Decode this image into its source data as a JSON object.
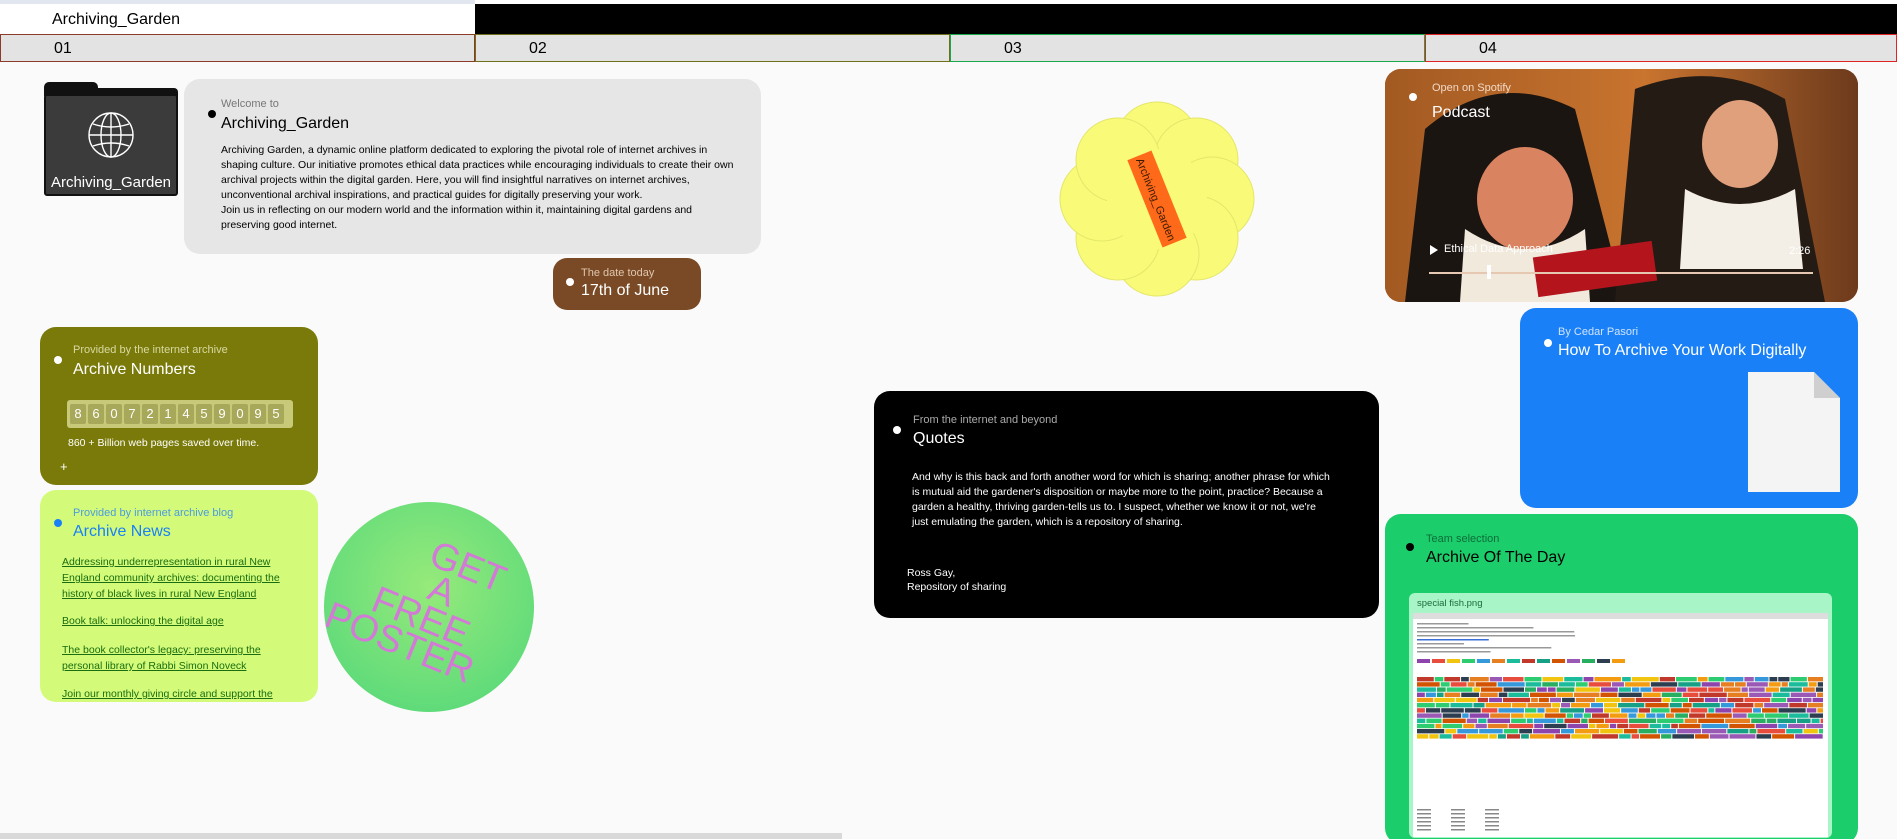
{
  "app_title": "Archiving_Garden",
  "columns": [
    "01",
    "02",
    "03",
    "04"
  ],
  "folder": {
    "label": "Archiving_Garden",
    "icon": "globe-icon"
  },
  "welcome": {
    "subtitle": "Welcome to",
    "title": "Archiving_Garden",
    "body1": "Archiving Garden, a dynamic online platform dedicated to exploring the pivotal role of internet archives in shaping culture. Our initiative promotes ethical data practices while encouraging individuals to create their own archival projects within the digital garden. Here, you will find insightful narratives on internet archives, unconventional archival inspirations, and practical guides for digitally preserving your work.",
    "body2": "Join us in reflecting on our modern world and the information within it, maintaining digital gardens and preserving good internet."
  },
  "date_card": {
    "subtitle": "The date today",
    "title": "17th of June"
  },
  "sticker": {
    "label": "Archiving_Garden",
    "petal_color": "#f8fa78",
    "tag_color": "#ff6a1a"
  },
  "podcast": {
    "subtitle": "Open on Spotify",
    "title": "Podcast",
    "track": "Ethical Data Approach",
    "duration": "2:26",
    "progress": 0.15
  },
  "howto": {
    "subtitle": "By Cedar Pasori",
    "title": "How To Archive Your Work Digitally",
    "icon": "document-icon"
  },
  "numbers": {
    "subtitle": "Provided by the internet archive",
    "title": "Archive Numbers",
    "digits": [
      "8",
      "6",
      "0",
      "7",
      "2",
      "1",
      "4",
      "5",
      "9",
      "0",
      "9",
      "5"
    ],
    "caption": "860 + Billion web pages saved over time.",
    "plus": "+"
  },
  "news": {
    "subtitle": "Provided by internet archive blog",
    "title": "Archive News",
    "items": [
      "Addressing underrepresentation in rural New England community archives: documenting the history of black lives in rural New England",
      "Book talk: unlocking the digital age",
      "The book collector's legacy: preserving the personal library of Rabbi Simon Noveck",
      "Join our monthly giving circle and support the"
    ]
  },
  "poster": {
    "line1": "GET",
    "line2": "A",
    "line3": "FREE",
    "line4": "POSTER"
  },
  "quotes": {
    "subtitle": "From the internet and beyond",
    "title": "Quotes",
    "body": "And why is this back and forth another word for which is sharing; another phrase for which is mutual aid the gardener's disposition or maybe more to the point, practice? Because a garden a healthy, thriving garden-tells us to. I suspect, whether we know it or not, we're just emulating the garden, which is a repository of sharing.",
    "author": "Ross Gay,",
    "source": "Repository of sharing"
  },
  "aotd": {
    "subtitle": "Team selection",
    "title": "Archive Of The Day",
    "filename": "special fish.png"
  },
  "colors": {
    "welcome_bg": "#e6e6e6",
    "date_bg": "#7a4a26",
    "numbers_bg": "#7a7a0b",
    "news_bg": "#d3fb79",
    "quotes_bg": "#000000",
    "howto_bg": "#1a80f7",
    "aotd_bg": "#1cce6b"
  }
}
